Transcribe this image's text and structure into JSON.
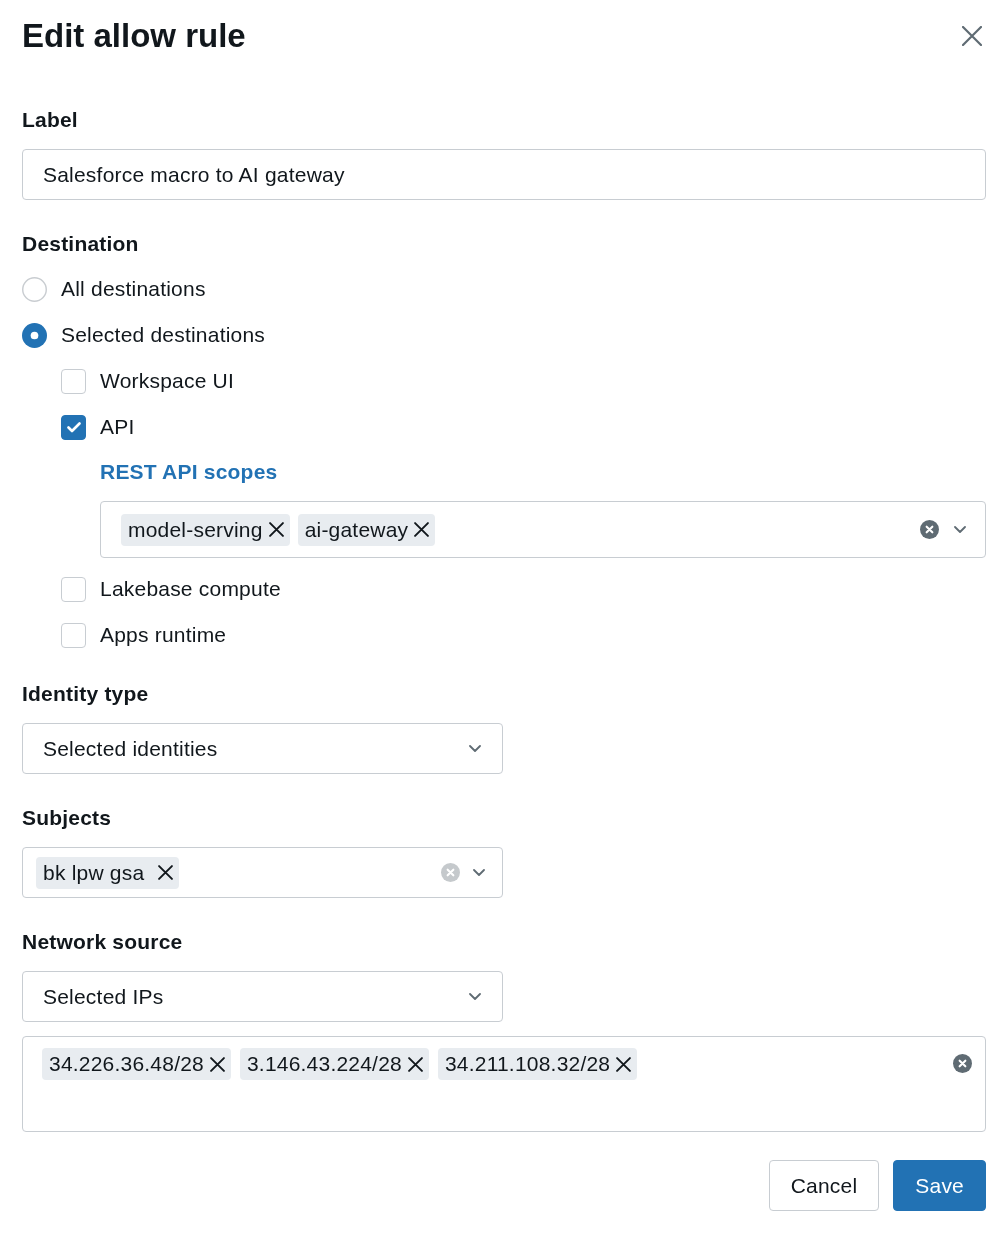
{
  "dialog": {
    "title": "Edit allow rule"
  },
  "label_field": {
    "label": "Label",
    "value": "Salesforce macro to AI gateway"
  },
  "destination": {
    "label": "Destination",
    "options": [
      {
        "label": "All destinations",
        "selected": false
      },
      {
        "label": "Selected destinations",
        "selected": true,
        "children": [
          {
            "label": "Workspace UI",
            "checked": false
          },
          {
            "label": "API",
            "checked": true,
            "scopes": {
              "link": "REST API scopes",
              "tags": [
                "model-serving",
                "ai-gateway"
              ]
            }
          },
          {
            "label": "Lakebase compute",
            "checked": false
          },
          {
            "label": "Apps runtime",
            "checked": false
          }
        ]
      }
    ]
  },
  "identity_type": {
    "label": "Identity type",
    "value": "Selected identities"
  },
  "subjects": {
    "label": "Subjects",
    "tags": [
      "bk lpw gsa"
    ]
  },
  "network_source": {
    "label": "Network source",
    "value": "Selected IPs",
    "ip_ranges": [
      "34.226.36.48/28",
      "3.146.43.224/28",
      "34.211.108.32/28"
    ]
  },
  "buttons": [
    {
      "label": "Cancel",
      "kind": "secondary"
    },
    {
      "label": "Save",
      "kind": "primary"
    }
  ]
}
